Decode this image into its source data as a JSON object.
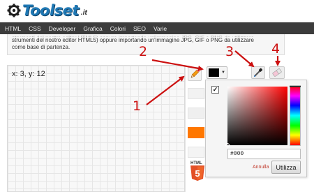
{
  "site": {
    "name": "Toolset",
    "tld": ".it"
  },
  "nav": {
    "items": [
      "HTML",
      "CSS",
      "Developer",
      "Grafica",
      "Colori",
      "SEO",
      "Varie"
    ]
  },
  "intro": {
    "faded_line": "strumenti del nostro editor HTML5) oppure importando un'immagine JPG, GIF o PNG da utilizzare",
    "line1": "strumenti del nostro editor HTML5) oppure importando un'immagine JPG, GIF o PNG da utilizzare",
    "line2": "come base di partenza."
  },
  "canvas": {
    "coords": "x: 3, y: 12"
  },
  "toolbar": {
    "current_color": "#000000",
    "accent_swatch": "#ff7700"
  },
  "color_picker": {
    "hex_value": "#000",
    "cancel_label": "Annulla",
    "use_label": "Utilizza",
    "checked": "✓"
  },
  "badge": {
    "label": "5"
  },
  "callouts": [
    "1",
    "2",
    "3",
    "4"
  ]
}
